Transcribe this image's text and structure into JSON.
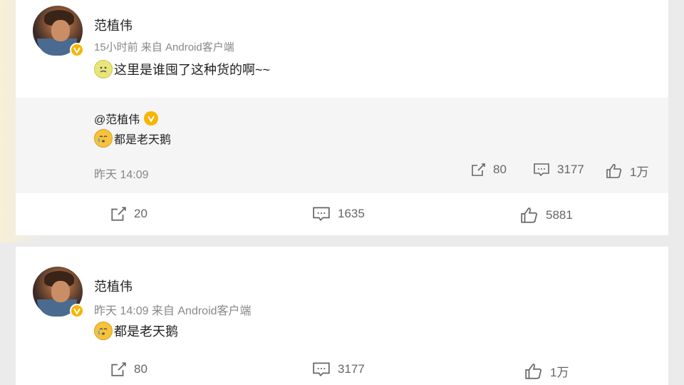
{
  "post1": {
    "author": "范植伟",
    "meta": "15小时前 来自 Android客户端",
    "text": "这里是谁囤了这种货的啊~~",
    "emoji": "sick-face-emoji",
    "repost": {
      "mention": "@范植伟",
      "text": "都是老天鹅",
      "emoji": "crying-face-emoji",
      "time": "昨天 14:09",
      "shares": "80",
      "comments": "3177",
      "likes": "1万"
    },
    "shares": "20",
    "comments": "1635",
    "likes": "5881"
  },
  "post2": {
    "author": "范植伟",
    "meta": "昨天 14:09 来自 Android客户端",
    "text": "都是老天鹅",
    "emoji": "crying-face-emoji",
    "shares": "80",
    "comments": "3177",
    "likes": "1万"
  },
  "colors": {
    "verified": "#f7b500",
    "background": "#ebebeb",
    "quote_bg": "#f5f5f5"
  }
}
